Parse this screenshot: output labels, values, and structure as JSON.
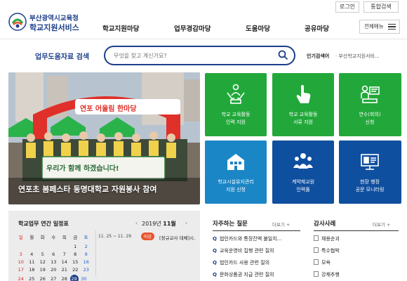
{
  "header": {
    "logo_line1": "부산광역시교육청",
    "logo_line2": "학교지원서비스",
    "login": "로그인",
    "total_search": "통합검색",
    "all_menu": "전체메뉴",
    "nav": [
      "학교지원마당",
      "업무경감마당",
      "도움마당",
      "공유마당"
    ]
  },
  "search": {
    "title": "업무도움자료 검색",
    "placeholder": "무엇을 찾고 계신가요?",
    "popular_label": "인기검색어",
    "popular_text": "· 부산학교지원서비..."
  },
  "hero": {
    "caption": "연포초 봄페스타 동명대학교 자원봉사 참여",
    "arch_text": "연포 어울림 한마당",
    "banner_text": "우리가 함께 하겠습니다!"
  },
  "tiles": [
    {
      "label": "학교 교육활동\n인력 지원",
      "icon": "people-hands-icon",
      "color": "green"
    },
    {
      "label": "학교 교육활동\n서류 지원",
      "icon": "hand-pointer-icon",
      "color": "green"
    },
    {
      "label": "연수(회의)\n신청",
      "icon": "presenter-icon",
      "color": "green"
    },
    {
      "label": "학교시설유지관리\n지원 신청",
      "icon": "building-icon",
      "color": "blue"
    },
    {
      "label": "계약제교원\n인력풀",
      "icon": "group-icon",
      "color": "navy"
    },
    {
      "label": "현장 행정\n공문 모니터링",
      "icon": "monitor-icon",
      "color": "navy"
    }
  ],
  "schedule": {
    "title": "학교업무 연간 일정표",
    "year": "2019년",
    "month": "11월",
    "weekdays": [
      "일",
      "월",
      "화",
      "수",
      "목",
      "금",
      "토"
    ],
    "weeks": [
      [
        "",
        "",
        "",
        "",
        "",
        "1",
        "2"
      ],
      [
        "3",
        "4",
        "5",
        "6",
        "7",
        "8",
        "9"
      ],
      [
        "10",
        "11",
        "12",
        "13",
        "14",
        "15",
        "16"
      ],
      [
        "17",
        "18",
        "19",
        "20",
        "21",
        "22",
        "23"
      ],
      [
        "24",
        "25",
        "26",
        "27",
        "28",
        "29",
        "30"
      ]
    ],
    "today": "29",
    "event_date": "11. 25 ~ 11. 29",
    "event_badge": "마감",
    "event_text": "[정규교사 대체]시..."
  },
  "faq": {
    "title": "자주하는 질문",
    "more": "더보기 +",
    "items": [
      "법인카드와 통장잔액 불일치...",
      "교육운영비 집행 관련 질의",
      "법인카드 사용 관련 질의",
      "문화상품권 지급 관련 질의"
    ]
  },
  "audit": {
    "title": "감사사례",
    "more": "더보기 +",
    "items": [
      "채용순괴",
      "특수협박",
      "모욕",
      "강제추행"
    ]
  },
  "colors": {
    "brand": "#1d3f8a",
    "tile_green": "#22a83a",
    "tile_blue": "#1b86c6",
    "tile_navy": "#0f4f9f",
    "badge": "#e8542f"
  }
}
